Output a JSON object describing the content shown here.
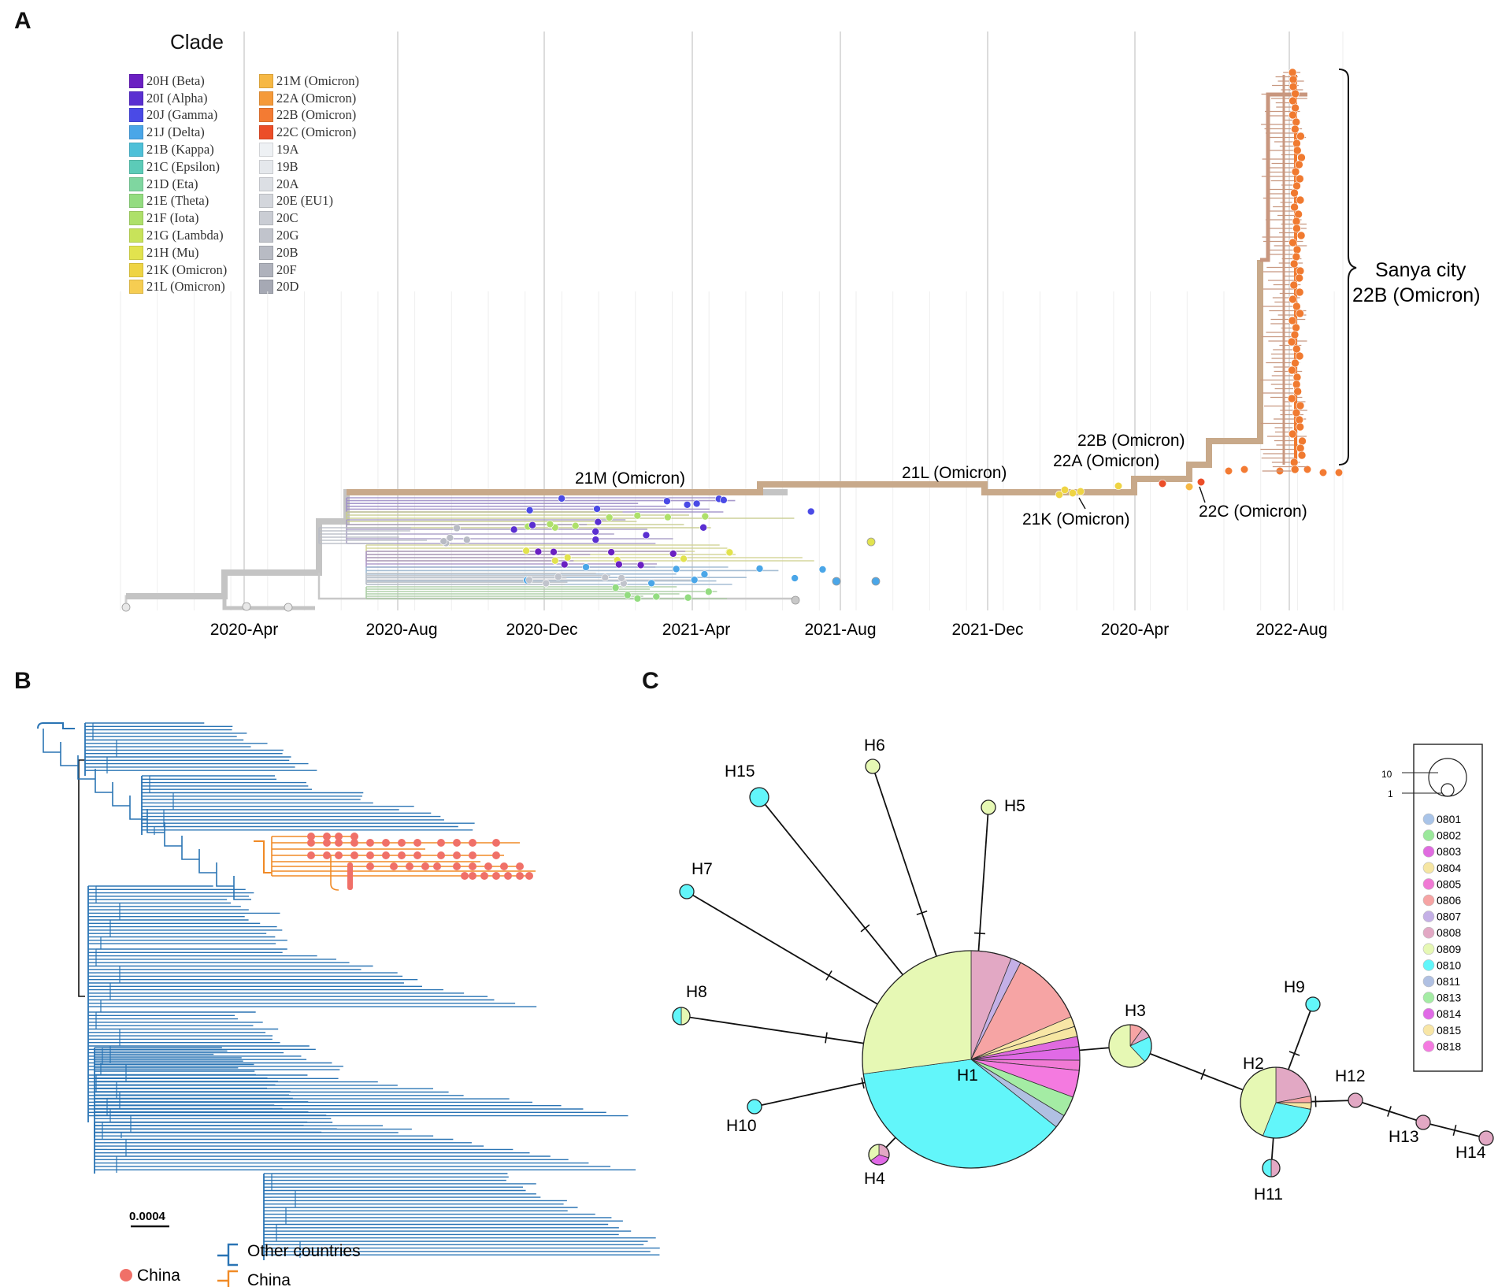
{
  "panels": {
    "a": "A",
    "b": "B",
    "c": "C"
  },
  "panel_a": {
    "legend_title": "Clade",
    "legend_col1": [
      {
        "label": "20H (Beta)",
        "color": "#6a1fc2"
      },
      {
        "label": "20I (Alpha)",
        "color": "#5a2fd1"
      },
      {
        "label": "20J (Gamma)",
        "color": "#4a4ae6"
      },
      {
        "label": "21J (Delta)",
        "color": "#4aa6e8"
      },
      {
        "label": "21B (Kappa)",
        "color": "#4ec0d8"
      },
      {
        "label": "21C (Epsilon)",
        "color": "#5ccbb8"
      },
      {
        "label": "21D (Eta)",
        "color": "#7fd6a0"
      },
      {
        "label": "21E (Theta)",
        "color": "#93dc80"
      },
      {
        "label": "21F (Iota)",
        "color": "#aee06a"
      },
      {
        "label": "21G (Lambda)",
        "color": "#c8e35a"
      },
      {
        "label": "21H (Mu)",
        "color": "#e2e34e"
      },
      {
        "label": "21K (Omicron)",
        "color": "#efd444"
      },
      {
        "label": "21L (Omicron)",
        "color": "#f6cd52"
      }
    ],
    "legend_col2": [
      {
        "label": "21M (Omicron)",
        "color": "#f6b844"
      },
      {
        "label": "22A (Omicron)",
        "color": "#f59a3a"
      },
      {
        "label": "22B (Omicron)",
        "color": "#f37b33"
      },
      {
        "label": "22C (Omicron)",
        "color": "#ec4e28"
      },
      {
        "label": "19A",
        "color": "#eef1f4"
      },
      {
        "label": "19B",
        "color": "#e5e8ec"
      },
      {
        "label": "20A",
        "color": "#dcdfe4"
      },
      {
        "label": "20E (EU1)",
        "color": "#d3d6dc"
      },
      {
        "label": "20C",
        "color": "#cacdd4"
      },
      {
        "label": "20G",
        "color": "#c1c4cc"
      },
      {
        "label": "20B",
        "color": "#b8bbc4"
      },
      {
        "label": "20F",
        "color": "#afb2bc"
      },
      {
        "label": "20D",
        "color": "#a6a9b4"
      }
    ],
    "axis_ticks": [
      "2020-Apr",
      "2020-Aug",
      "2020-Dec",
      "2021-Apr",
      "2021-Aug",
      "2021-Dec",
      "2020-Apr",
      "2022-Aug"
    ],
    "annotations": {
      "sanya_line1": "Sanya city",
      "sanya_line2": "22B (Omicron)",
      "c21m": "21M (Omicron)",
      "c21l": "21L (Omicron)",
      "c22b": "22B (Omicron)",
      "c22a": "22A (Omicron)",
      "c21k": "21K (Omicron)",
      "c22c": "22C (Omicron)"
    }
  },
  "panel_b": {
    "scale_label": "0.0004",
    "legend": {
      "china_dot": "China",
      "other_countries": "Other countries",
      "china_branch": "China"
    },
    "colors": {
      "other": "#2a74b4",
      "china_branch": "#f08a26",
      "china_dot": "#f07068"
    }
  },
  "panel_c": {
    "nodes": [
      {
        "id": "H1",
        "label": "H1",
        "size": 10
      },
      {
        "id": "H2",
        "label": "H2",
        "size": 4
      },
      {
        "id": "H3",
        "label": "H3",
        "size": 2
      },
      {
        "id": "H4",
        "label": "H4",
        "size": 1
      },
      {
        "id": "H5",
        "label": "H5",
        "size": 1
      },
      {
        "id": "H6",
        "label": "H6",
        "size": 1
      },
      {
        "id": "H7",
        "label": "H7",
        "size": 1
      },
      {
        "id": "H8",
        "label": "H8",
        "size": 1
      },
      {
        "id": "H9",
        "label": "H9",
        "size": 1
      },
      {
        "id": "H10",
        "label": "H10",
        "size": 1
      },
      {
        "id": "H11",
        "label": "H11",
        "size": 1
      },
      {
        "id": "H12",
        "label": "H12",
        "size": 1
      },
      {
        "id": "H13",
        "label": "H13",
        "size": 1
      },
      {
        "id": "H14",
        "label": "H14",
        "size": 1
      },
      {
        "id": "H15",
        "label": "H15",
        "size": 1
      }
    ],
    "size_legend": {
      "big": "10",
      "small": "1"
    },
    "color_legend": [
      {
        "label": "0801",
        "color": "#a9c4e8"
      },
      {
        "label": "0802",
        "color": "#9be89b"
      },
      {
        "label": "0803",
        "color": "#e06be0"
      },
      {
        "label": "0804",
        "color": "#f6e6a2"
      },
      {
        "label": "0805",
        "color": "#f07ad4"
      },
      {
        "label": "0806",
        "color": "#f6a4a4"
      },
      {
        "label": "0807",
        "color": "#c4b0e6"
      },
      {
        "label": "0808",
        "color": "#e2a8c4"
      },
      {
        "label": "0809",
        "color": "#e6f8b4"
      },
      {
        "label": "0810",
        "color": "#62f6fa"
      },
      {
        "label": "0811",
        "color": "#b0c0e2"
      },
      {
        "label": "0813",
        "color": "#a4eca4"
      },
      {
        "label": "0814",
        "color": "#e06ae6"
      },
      {
        "label": "0815",
        "color": "#f8e6a6"
      },
      {
        "label": "0818",
        "color": "#f47ae0"
      }
    ]
  }
}
